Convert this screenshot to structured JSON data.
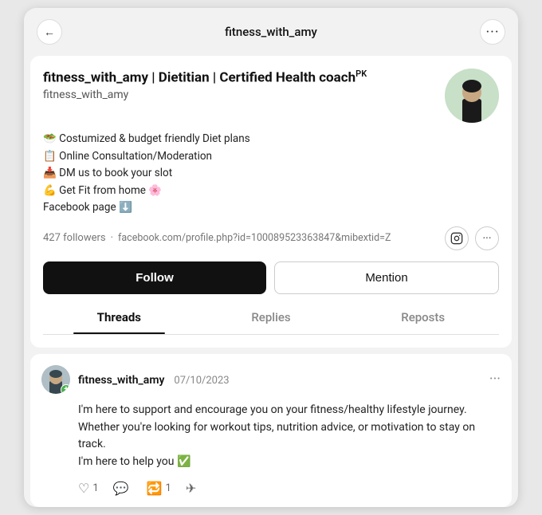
{
  "topBar": {
    "title": "fitness_with_amy",
    "backIcon": "←",
    "moreIcon": "···"
  },
  "profile": {
    "name": "fitness_with_amy | Dietitian | Certified Health coach",
    "nameSuffix": "PK",
    "username": "fitness_with_amy",
    "bioLines": [
      "🥗 Costumized & budget friendly Diet plans",
      "📋 Online Consultation/Moderation",
      "📥 DM us to book your slot",
      "💪 Get Fit from home 🌸",
      "Facebook page ⬇️"
    ],
    "followers": "427 followers",
    "separator": "·",
    "fbLink": "facebook.com/profile.php?id=100089523363847&mibextid=Z",
    "instagramIcon": "instagram",
    "moreIcon": "more-social"
  },
  "actions": {
    "followLabel": "Follow",
    "mentionLabel": "Mention"
  },
  "tabs": [
    {
      "label": "Threads",
      "active": true
    },
    {
      "label": "Replies",
      "active": false
    },
    {
      "label": "Reposts",
      "active": false
    }
  ],
  "thread": {
    "username": "fitness_with_amy",
    "date": "07/10/2023",
    "moreIcon": "···",
    "body": "I'm here to support and encourage you on your fitness/healthy lifestyle journey. Whether you're looking for workout tips, nutrition advice, or motivation to stay on track.\nI'm here to help you ✅",
    "actions": {
      "like": {
        "icon": "♡",
        "count": "1"
      },
      "comment": {
        "icon": "💬",
        "count": ""
      },
      "repost": {
        "icon": "🔁",
        "count": "1"
      },
      "share": {
        "icon": "✈",
        "count": ""
      }
    }
  }
}
